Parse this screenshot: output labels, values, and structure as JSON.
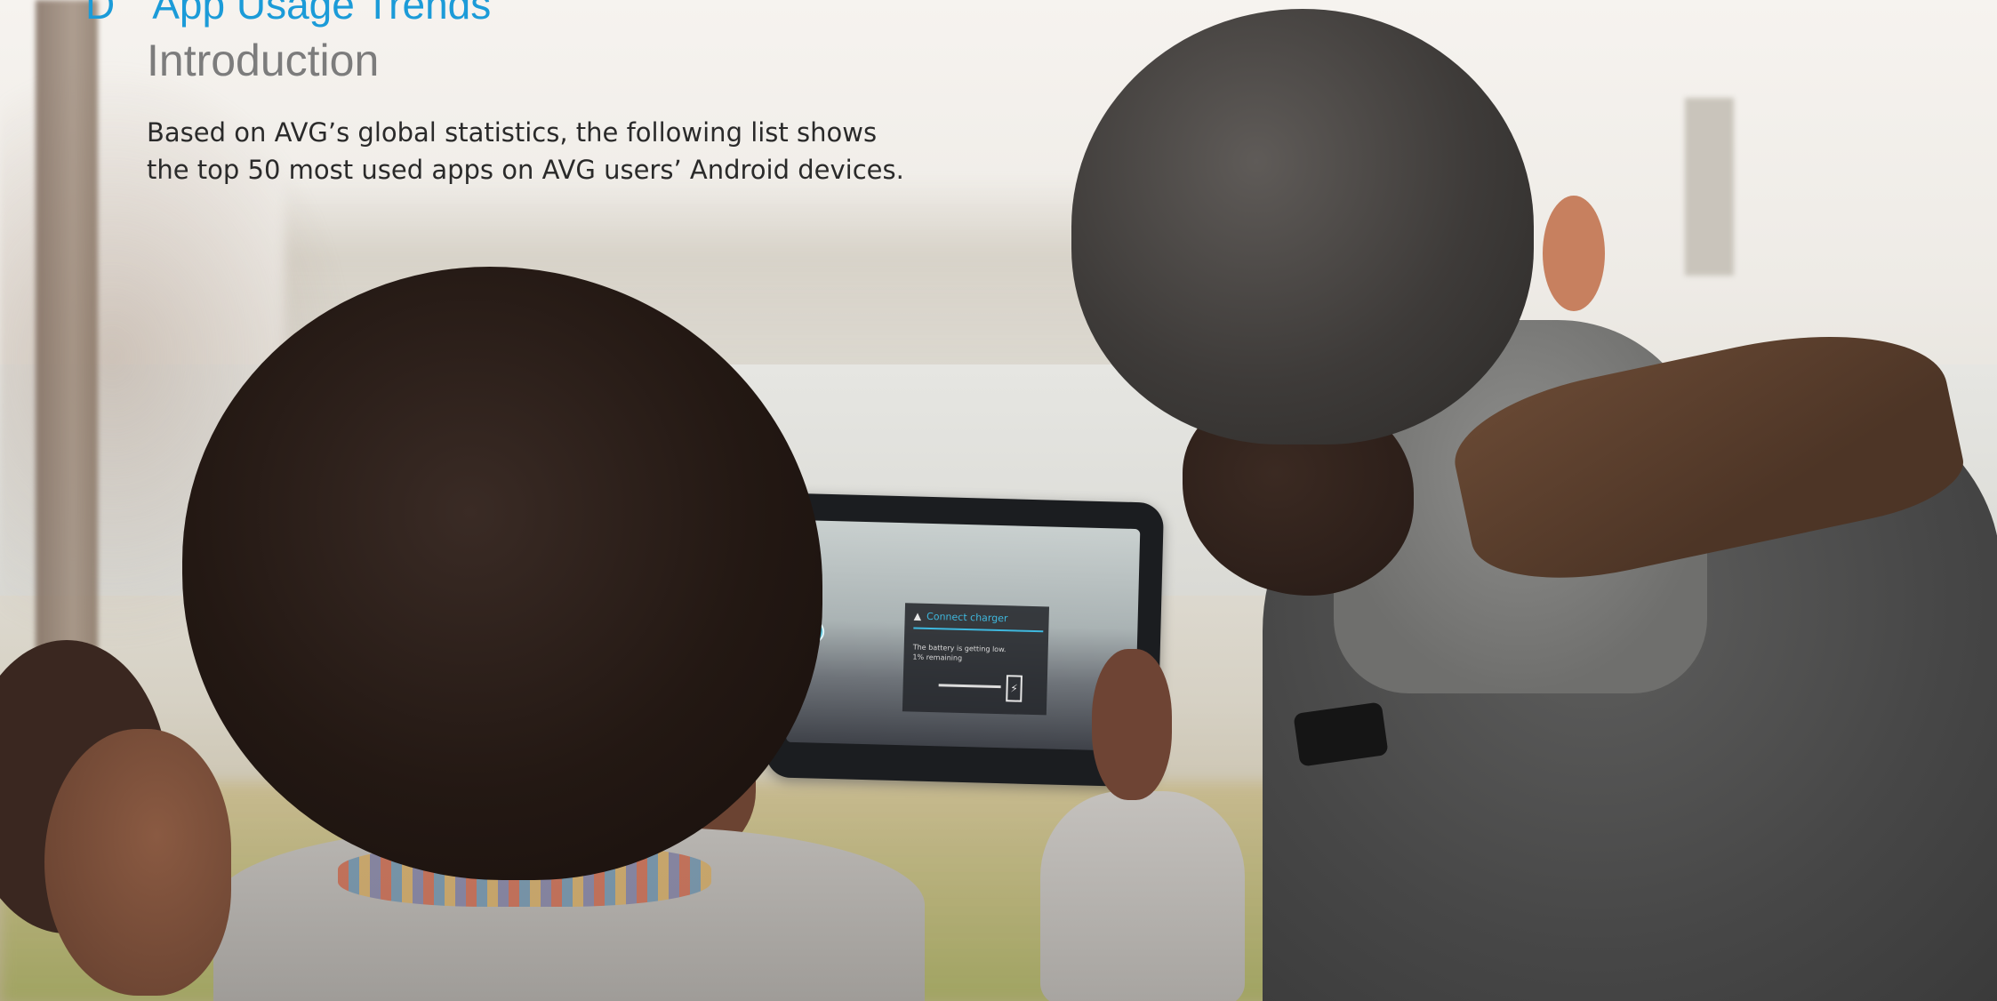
{
  "heading": {
    "section_letter": "D",
    "title": "App Usage Trends",
    "subtitle": "Introduction"
  },
  "intro": {
    "line1": "Based on AVG’s global statistics, the following list shows",
    "line2": "the top 50 most used apps on AVG users’ Android devices."
  },
  "tablet_notification": {
    "title": "Connect charger",
    "body_line1": "The battery is getting low.",
    "body_line2": "1% remaining"
  },
  "colors": {
    "accent": "#1b9bd8",
    "subtitle_gray": "#7c7c7c",
    "body_text": "#2a2a2a"
  }
}
